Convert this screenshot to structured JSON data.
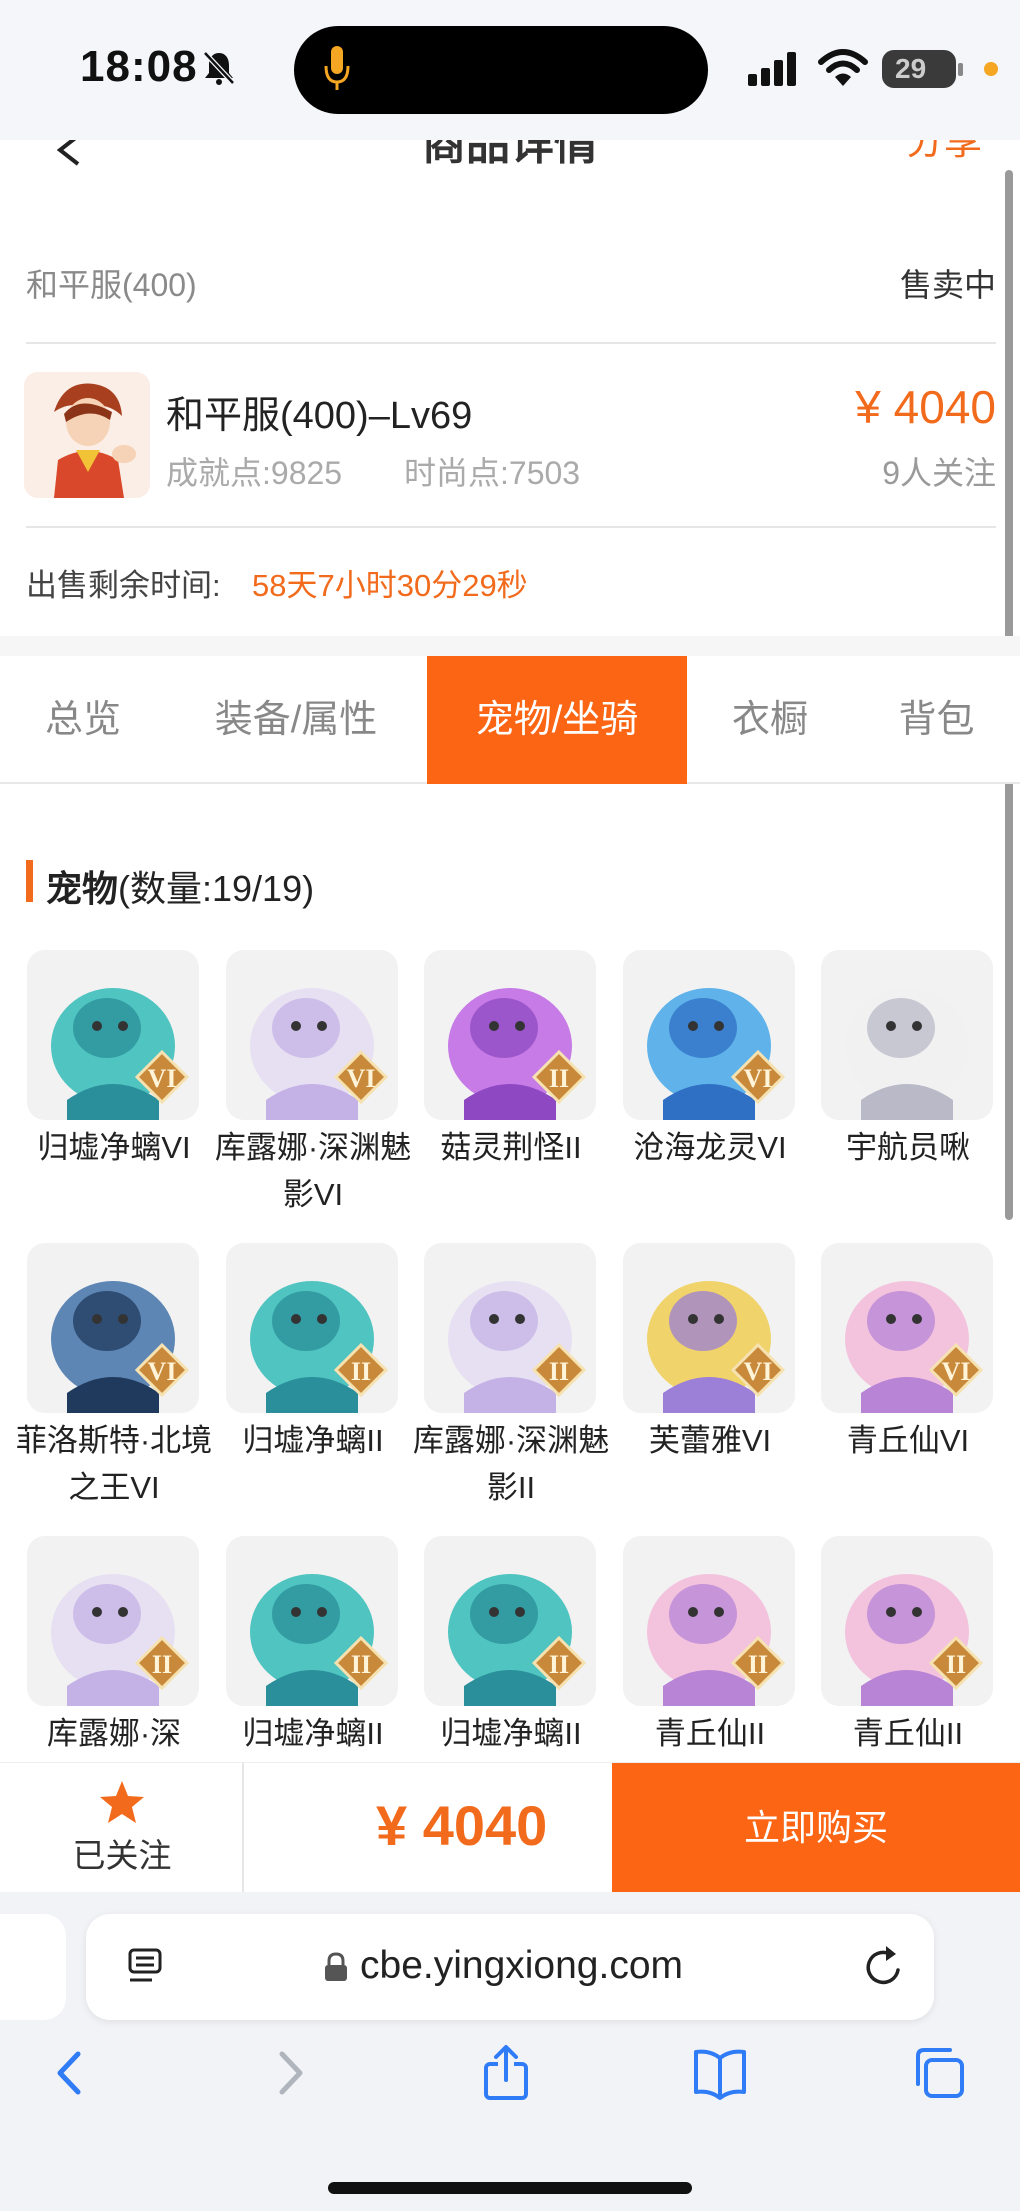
{
  "status_bar": {
    "time": "18:08",
    "battery": "29"
  },
  "header": {
    "title": "商品详情",
    "share": "分享"
  },
  "product": {
    "server": "和平服(400)",
    "status": "售卖中",
    "role_name": "和平服(400)–Lv69",
    "achievement": "成就点:9825",
    "fashion": "时尚点:7503",
    "price": "¥ 4040",
    "followers": "9人关注",
    "remaining_label": "出售剩余时间:",
    "remaining_value": "58天7小时30分29秒"
  },
  "tabs": [
    "总览",
    "装备/属性",
    "宠物/坐骑",
    "衣橱",
    "背包"
  ],
  "active_tab": "宠物/坐骑",
  "section": {
    "title": "宠物",
    "count": "(数量:19/19)"
  },
  "pets": [
    {
      "name": "归墟净螭VI",
      "rank": "VI"
    },
    {
      "name": "库露娜·深渊魅影VI",
      "rank": "VI"
    },
    {
      "name": "菇灵荆怪II",
      "rank": "II"
    },
    {
      "name": "沧海龙灵VI",
      "rank": "VI"
    },
    {
      "name": "宇航员啾",
      "rank": ""
    },
    {
      "name": "菲洛斯特·北境之王VI",
      "rank": "VI"
    },
    {
      "name": "归墟净螭II",
      "rank": "II"
    },
    {
      "name": "库露娜·深渊魅影II",
      "rank": "II"
    },
    {
      "name": "芙蕾雅VI",
      "rank": "VI"
    },
    {
      "name": "青丘仙VI",
      "rank": "VI"
    },
    {
      "name": "库露娜·深",
      "rank": "II"
    },
    {
      "name": "归墟净螭II",
      "rank": "II"
    },
    {
      "name": "归墟净螭II",
      "rank": "II"
    },
    {
      "name": "青丘仙II",
      "rank": "II"
    },
    {
      "name": "青丘仙II",
      "rank": "II"
    }
  ],
  "action_bar": {
    "follow_label": "已关注",
    "price": "¥ 4040",
    "buy_label": "立即购买"
  },
  "browser": {
    "url": "cbe.yingxiong.com"
  },
  "colors": {
    "accent": "#fb6513",
    "price": "#f26a1b",
    "rank_badge": "#c8893a"
  }
}
